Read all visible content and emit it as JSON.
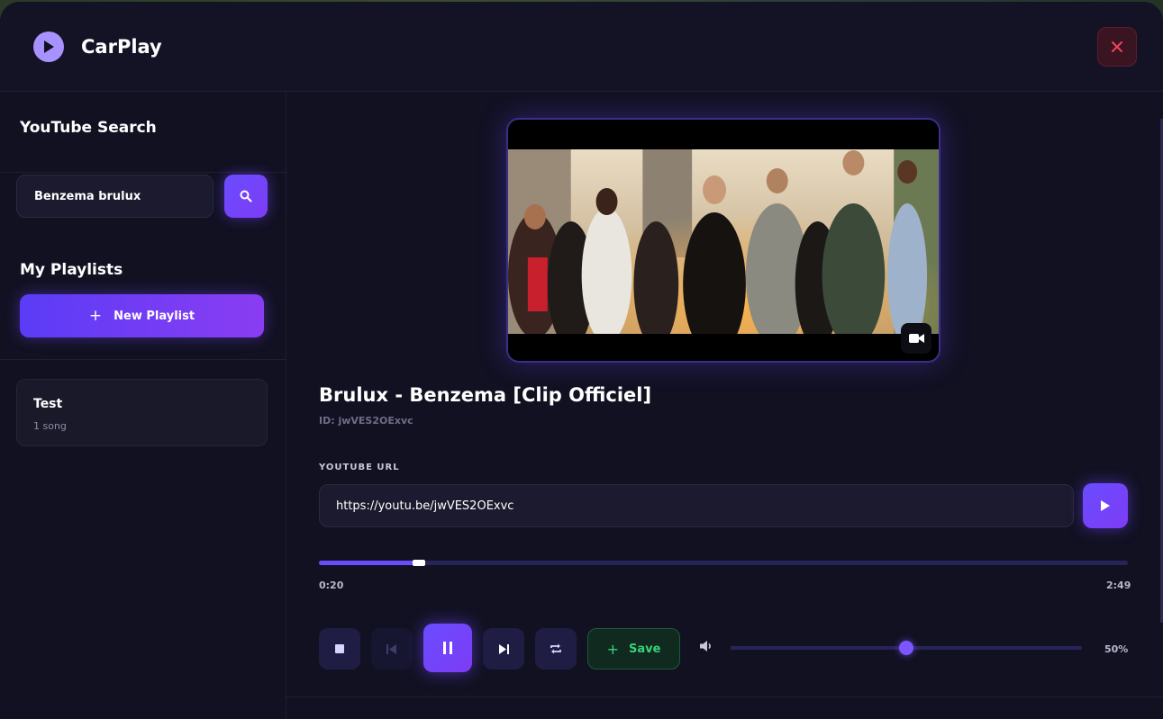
{
  "app": {
    "title": "CarPlay"
  },
  "sidebar": {
    "search_heading": "YouTube Search",
    "search_value": "Benzema brulux",
    "playlists_heading": "My Playlists",
    "new_playlist_label": "New Playlist",
    "playlists": [
      {
        "name": "Test",
        "count": "1 song"
      }
    ]
  },
  "player": {
    "title": "Brulux - Benzema [Clip Officiel]",
    "id_text": "ID: jwVES2OExvc",
    "url_label": "YOUTUBE URL",
    "url_value": "https://youtu.be/jwVES2OExvc",
    "current_time": "0:20",
    "duration": "2:49",
    "progress_fraction": 0.118,
    "save_label": "Save",
    "volume_fraction": 0.5,
    "volume_text": "50%"
  },
  "colors": {
    "accent": "#6a4cff",
    "save_green": "#38d27a",
    "close_red": "#f0425c",
    "background": "#121122"
  },
  "icons": {
    "logo": "play-circle-icon",
    "close": "close-icon",
    "search": "search-icon",
    "add": "plus-icon",
    "video_badge": "video-camera-icon",
    "url_play": "play-icon",
    "stop": "stop-icon",
    "previous": "skip-previous-icon",
    "pause": "pause-icon",
    "next": "skip-next-icon",
    "repeat": "repeat-icon",
    "volume": "volume-icon"
  }
}
